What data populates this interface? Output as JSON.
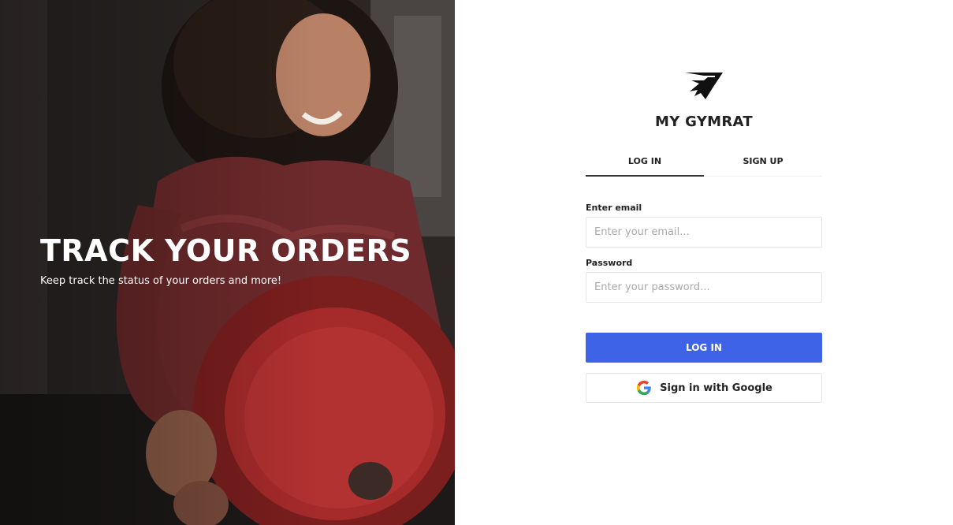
{
  "hero": {
    "title": "TRACK YOUR ORDERS",
    "subtitle": "Keep track the status of your orders and more!"
  },
  "brand": {
    "name": "MY GYMRAT",
    "logo_icon": "gymshark-shark-icon"
  },
  "tabs": [
    {
      "label": "LOG IN",
      "active": true
    },
    {
      "label": "SIGN UP",
      "active": false
    }
  ],
  "form": {
    "email_label": "Enter email",
    "email_placeholder": "Enter your email...",
    "password_label": "Password",
    "password_placeholder": "Enter your password...",
    "login_button": "LOG IN",
    "google_button": "Sign in with Google"
  },
  "colors": {
    "primary": "#3e63e6",
    "hero_overlay_text": "#ffffff"
  }
}
